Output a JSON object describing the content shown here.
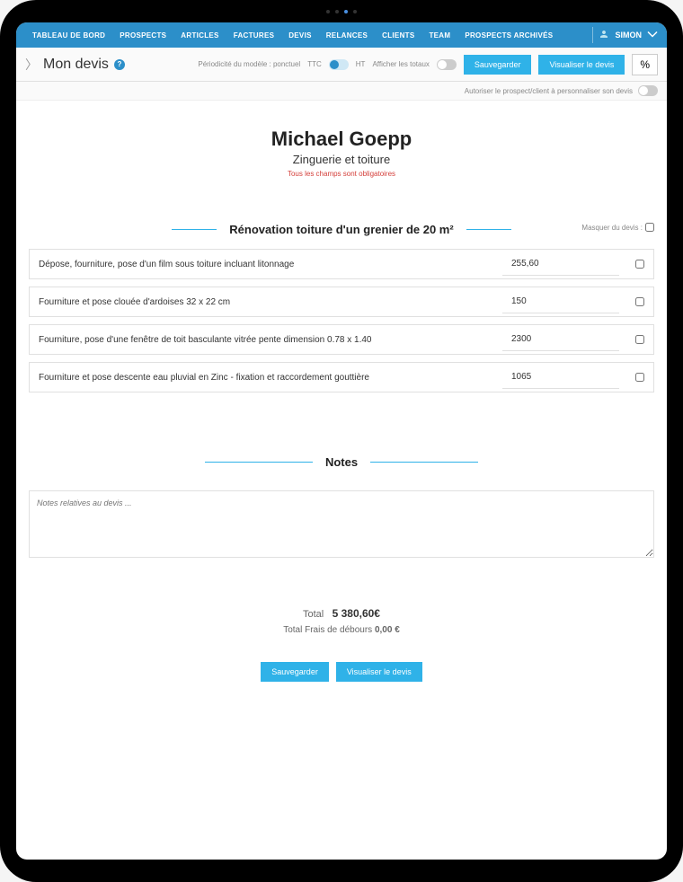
{
  "nav": {
    "items": [
      "TABLEAU DE BORD",
      "PROSPECTS",
      "ARTICLES",
      "FACTURES",
      "DEVIS",
      "RELANCES",
      "CLIENTS",
      "TEAM",
      "PROSPECTS ARCHIVÉS"
    ],
    "user": "SIMON"
  },
  "toolbar": {
    "back_chevron": "›",
    "title": "Mon devis",
    "periodicity_label": "Périodicité du modèle : ponctuel",
    "ttc_label": "TTC",
    "ht_label": "HT",
    "show_totals_label": "Afficher les totaux",
    "save_label": "Sauvegarder",
    "visualize_label": "Visualiser le devis",
    "percent_symbol": "%",
    "personalize_label": "Autoriser le prospect/client à personnaliser son devis"
  },
  "header": {
    "customer_name": "Michael Goepp",
    "subtitle": "Zinguerie et toiture",
    "mandatory": "Tous les champs sont obligatoires"
  },
  "section": {
    "title": "Rénovation toiture d'un grenier de 20 m²",
    "hide_label": "Masquer du devis :"
  },
  "items": [
    {
      "desc": "Dépose, fourniture, pose d'un film sous toiture incluant litonnage",
      "price": "255,60"
    },
    {
      "desc": "Fourniture et pose clouée d'ardoises 32 x 22 cm",
      "price": "150"
    },
    {
      "desc": "Fourniture, pose d'une fenêtre de toit basculante vitrée pente dimension 0.78 x 1.40",
      "price": "2300"
    },
    {
      "desc": "Fourniture et pose descente eau pluvial en Zinc - fixation et raccordement gouttière",
      "price": "1065"
    }
  ],
  "notes": {
    "title": "Notes",
    "placeholder": "Notes relatives au devis ..."
  },
  "totals": {
    "total_label": "Total",
    "total_value": "5 380,60€",
    "fees_label": "Total Frais de débours",
    "fees_value": "0,00 €"
  },
  "actions": {
    "save": "Sauvegarder",
    "visualize": "Visualiser le devis"
  },
  "colors": {
    "primary": "#2fb2e8",
    "nav": "#2c8fc9"
  }
}
